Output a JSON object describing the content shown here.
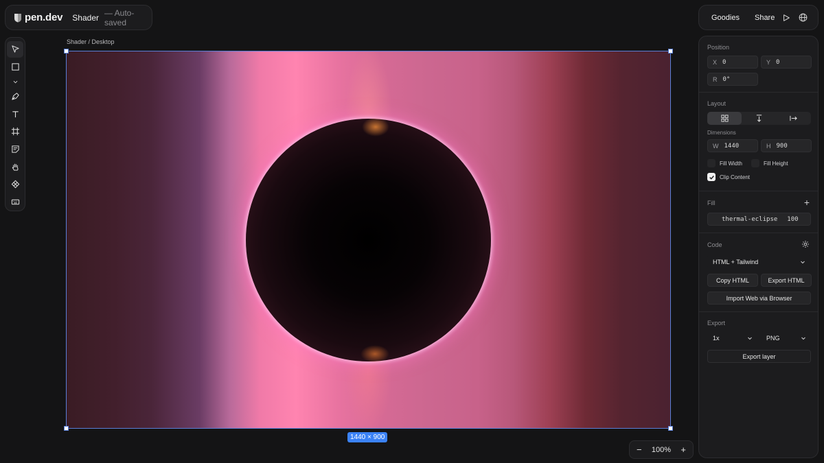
{
  "header": {
    "logo_text": "pen.dev",
    "file_name": "Shader",
    "save_status": "— Auto-saved"
  },
  "top_actions": {
    "goodies": "Goodies",
    "share": "Share",
    "icons": [
      "play-icon",
      "globe-icon"
    ]
  },
  "toolbar": {
    "tools": [
      "cursor-icon",
      "rectangle-icon",
      "chevron-down-icon",
      "pen-icon",
      "text-icon",
      "frame-icon",
      "sticky-note-icon",
      "hand-icon",
      "component-icon",
      "keyboard-icon"
    ]
  },
  "canvas": {
    "breadcrumb": "Shader / Desktop",
    "dimensions_badge": "1440 × 900",
    "zoom": "100%",
    "zoom_minus": "−",
    "zoom_plus": "+"
  },
  "panel": {
    "position": {
      "title": "Position",
      "x_label": "X",
      "x_value": "0",
      "y_label": "Y",
      "y_value": "0",
      "r_label": "R",
      "r_value": "0°"
    },
    "layout": {
      "title": "Layout",
      "dimensions_title": "Dimensions",
      "w_label": "W",
      "w_value": "1440",
      "h_label": "H",
      "h_value": "900",
      "fill_width": "Fill Width",
      "fill_height": "Fill Height",
      "clip_content": "Clip Content",
      "clip_checked": true
    },
    "fill": {
      "title": "Fill",
      "shader_name": "thermal-eclipse",
      "opacity": "100"
    },
    "code": {
      "title": "Code",
      "format": "HTML + Tailwind",
      "copy_html": "Copy HTML",
      "export_html": "Export HTML",
      "import_web": "Import Web via Browser"
    },
    "export": {
      "title": "Export",
      "scale": "1x",
      "format": "PNG",
      "export_layer": "Export layer"
    }
  },
  "colors": {
    "accent": "#3b82f6",
    "selection": "#5a7fd8"
  }
}
